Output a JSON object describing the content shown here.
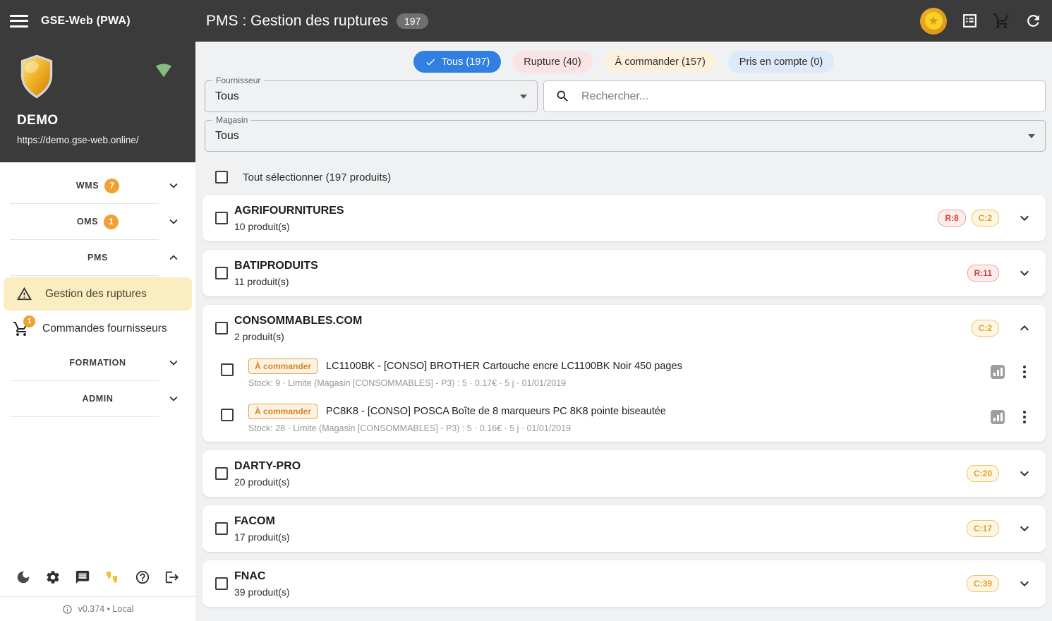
{
  "app": {
    "name": "GSE-Web (PWA)",
    "page_title": "PMS : Gestion des ruptures",
    "page_count": "197",
    "header_icons": [
      "star-badge-icon",
      "list-alt-icon",
      "cart-icon",
      "refresh-icon"
    ]
  },
  "sidebar": {
    "tenant": {
      "name": "DEMO",
      "url": "https://demo.gse-web.online/"
    },
    "status_icon": "wifi-online-icon",
    "nav": [
      {
        "label": "WMS",
        "badge": "7"
      },
      {
        "label": "OMS",
        "badge": "1"
      },
      {
        "label": "PMS",
        "badge": null
      }
    ],
    "pms_items": [
      {
        "label": "Gestion des ruptures",
        "icon": "warning-icon",
        "active": true
      },
      {
        "label": "Commandes fournisseurs",
        "icon": "cart-icon",
        "badge": "1"
      }
    ],
    "nav2": [
      {
        "label": "FORMATION"
      },
      {
        "label": "ADMIN"
      }
    ],
    "footer_icons": [
      "moon-icon",
      "gear-icon",
      "chat-icon",
      "feedback-icon",
      "help-icon",
      "logout-icon"
    ],
    "version": "v0.374 • Local"
  },
  "filters": {
    "chips": [
      {
        "label": "Tous (197)",
        "selected": true
      },
      {
        "label": "Rupture (40)",
        "selected": false
      },
      {
        "label": "À commander (157)",
        "selected": false
      },
      {
        "label": "Pris en compte (0)",
        "selected": false
      }
    ],
    "fournisseur": {
      "label": "Fournisseur",
      "value": "Tous"
    },
    "magasin": {
      "label": "Magasin",
      "value": "Tous"
    },
    "search_placeholder": "Rechercher..."
  },
  "list": {
    "select_all": "Tout sélectionner (197 produits)",
    "suppliers": [
      {
        "name": "AGRIFOURNITURES",
        "count": "10 produit(s)",
        "badges": [
          "R:8",
          "C:2"
        ],
        "expanded": false
      },
      {
        "name": "BATIPRODUITS",
        "count": "11 produit(s)",
        "badges": [
          "R:11"
        ],
        "expanded": false
      },
      {
        "name": "CONSOMMABLES.COM",
        "count": "2 produit(s)",
        "badges": [
          "C:2"
        ],
        "expanded": true,
        "products": [
          {
            "status": "À commander",
            "title": "LC1100BK - [CONSO] BROTHER Cartouche encre LC1100BK Noir 450 pages",
            "stats": "Stock: 9 · Limite (Magasin [CONSOMMABLES] - P3) : 5 · 0.17€ · 5 j · 01/01/2019"
          },
          {
            "status": "À commander",
            "title": "PC8K8 - [CONSO] POSCA Boîte de 8 marqueurs PC 8K8 pointe biseautée",
            "stats": "Stock: 28 · Limite (Magasin [CONSOMMABLES] - P3) : 5 · 0.16€ · 5 j · 01/01/2019"
          }
        ]
      },
      {
        "name": "DARTY-PRO",
        "count": "20 produit(s)",
        "badges": [
          "C:20"
        ],
        "expanded": false
      },
      {
        "name": "FACOM",
        "count": "17 produit(s)",
        "badges": [
          "C:17"
        ],
        "expanded": false
      },
      {
        "name": "FNAC",
        "count": "39 produit(s)",
        "badges": [
          "C:39"
        ],
        "expanded": false
      }
    ]
  },
  "colors": {
    "topbar_bg": "#3b3b3b",
    "accent_blue": "#3180e1",
    "accent_orange": "#f0a132",
    "rupture_red": "#d5433d",
    "commander_orange": "#e09c34",
    "active_item_bg": "#faedc2",
    "main_bg": "#eff1f3"
  }
}
